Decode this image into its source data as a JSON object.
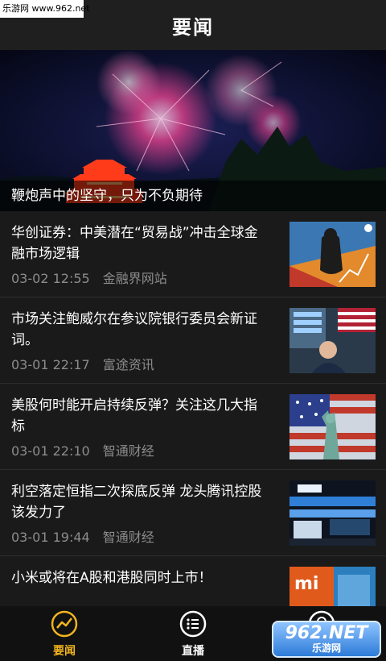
{
  "watermark": {
    "top_text": "乐游网 www.962.net",
    "bottom_logo": "962.NET",
    "bottom_sub": "乐游网"
  },
  "header": {
    "title": "要闻"
  },
  "banner": {
    "caption": "鞭炮声中的坚守，只为不负期待"
  },
  "news": [
    {
      "title": "华创证券：中美潜在“贸易战”冲击全球金融市场逻辑",
      "date": "03-02 12:55",
      "source": "金融界网站"
    },
    {
      "title": "市场关注鲍威尔在参议院银行委员会新证词。",
      "date": "03-01 22:17",
      "source": "富途资讯"
    },
    {
      "title": "美股何时能开启持续反弹？关注这几大指标",
      "date": "03-01 22:10",
      "source": "智通财经"
    },
    {
      "title": "利空落定恒指二次探底反弹 龙头腾讯控股该发力了",
      "date": "03-01 19:44",
      "source": "智通财经"
    },
    {
      "title": "小米或将在A股和港股同时上市！",
      "date": "",
      "source": ""
    }
  ],
  "tabs": [
    {
      "label": "要闻",
      "icon": "trend-icon",
      "active": true
    },
    {
      "label": "直播",
      "icon": "list-icon",
      "active": false
    },
    {
      "label": "我",
      "icon": "user-icon",
      "active": false
    }
  ],
  "colors": {
    "accent": "#f2b41e",
    "background": "#1a1a1a",
    "meta_text": "#8c8c8c"
  }
}
